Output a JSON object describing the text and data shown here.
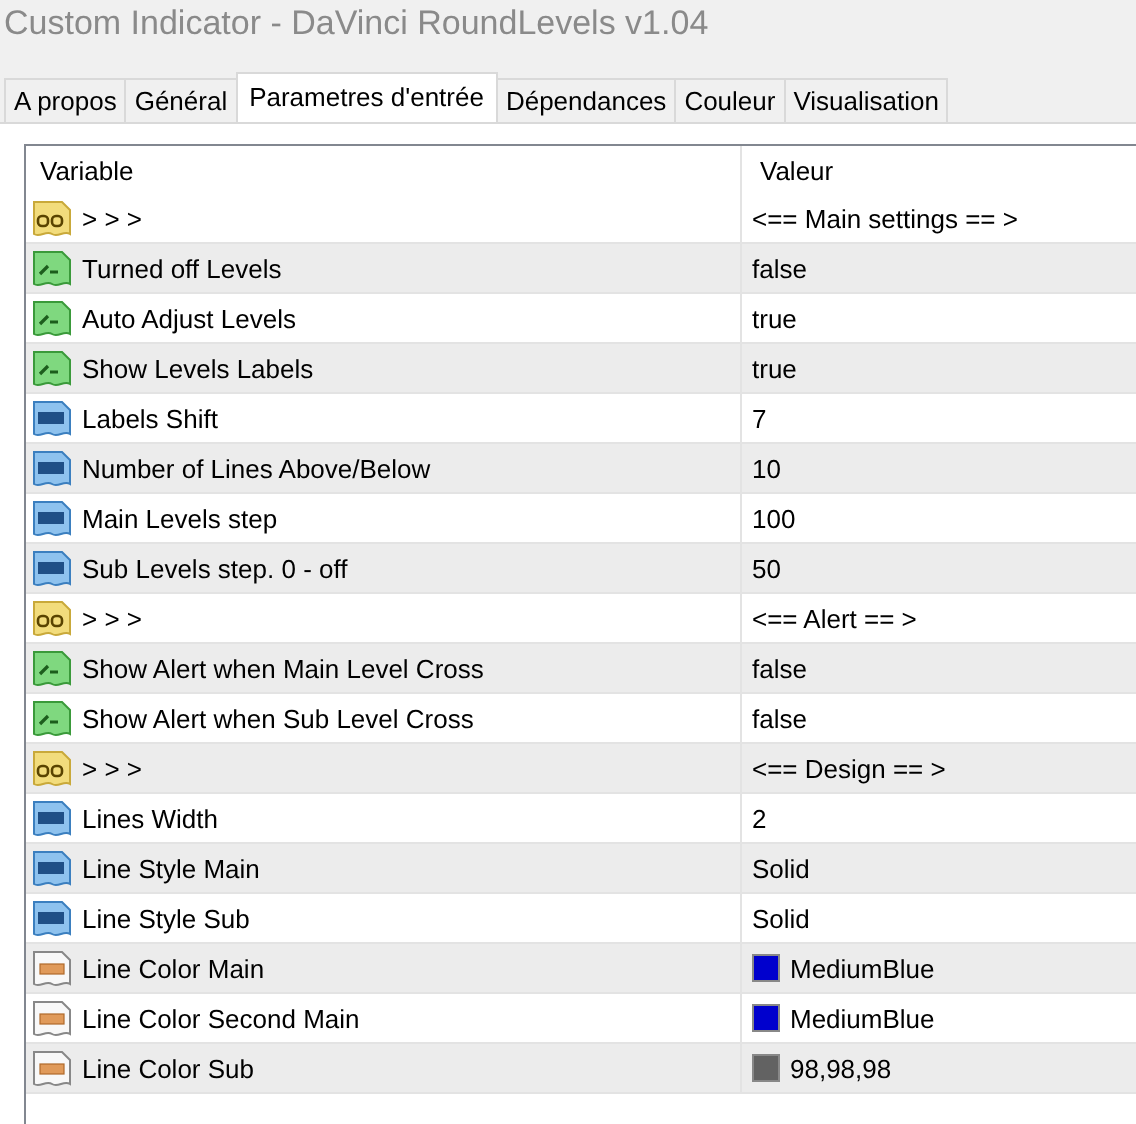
{
  "window": {
    "title": "Custom Indicator - DaVinci RoundLevels v1.04"
  },
  "tabs": [
    {
      "label": "A propos",
      "selected": false
    },
    {
      "label": "Général",
      "selected": false
    },
    {
      "label": "Parametres d'entrée",
      "selected": true
    },
    {
      "label": "Dépendances",
      "selected": false
    },
    {
      "label": "Couleur",
      "selected": false
    },
    {
      "label": "Visualisation",
      "selected": false
    }
  ],
  "table": {
    "columns": [
      "Variable",
      "Valeur"
    ],
    "rows": [
      {
        "kind": "string",
        "variable": "> > >",
        "value": "<== Main settings == >"
      },
      {
        "kind": "bool",
        "variable": "Turned off Levels",
        "value": "false"
      },
      {
        "kind": "bool",
        "variable": "Auto Adjust Levels",
        "value": "true"
      },
      {
        "kind": "bool",
        "variable": "Show Levels Labels",
        "value": "true"
      },
      {
        "kind": "int",
        "variable": "Labels Shift",
        "value": "7"
      },
      {
        "kind": "int",
        "variable": "Number of Lines Above/Below",
        "value": "10"
      },
      {
        "kind": "int",
        "variable": "Main Levels step",
        "value": "100"
      },
      {
        "kind": "int",
        "variable": "Sub Levels step. 0 - off",
        "value": "50"
      },
      {
        "kind": "string",
        "variable": "> > >",
        "value": "<== Alert == >"
      },
      {
        "kind": "bool",
        "variable": "Show Alert when Main Level Cross",
        "value": "false"
      },
      {
        "kind": "bool",
        "variable": "Show Alert when Sub Level Cross",
        "value": "false"
      },
      {
        "kind": "string",
        "variable": "> > >",
        "value": "<== Design == >"
      },
      {
        "kind": "int",
        "variable": "Lines Width",
        "value": "2"
      },
      {
        "kind": "int",
        "variable": "Line Style Main",
        "value": "Solid"
      },
      {
        "kind": "int",
        "variable": "Line Style Sub",
        "value": "Solid"
      },
      {
        "kind": "color",
        "variable": "Line Color Main",
        "value": "MediumBlue",
        "color": "#0000cd"
      },
      {
        "kind": "color",
        "variable": "Line Color Second Main",
        "value": "MediumBlue",
        "color": "#0000cd"
      },
      {
        "kind": "color",
        "variable": "Line Color Sub",
        "value": "98,98,98",
        "color": "#626262"
      }
    ]
  }
}
